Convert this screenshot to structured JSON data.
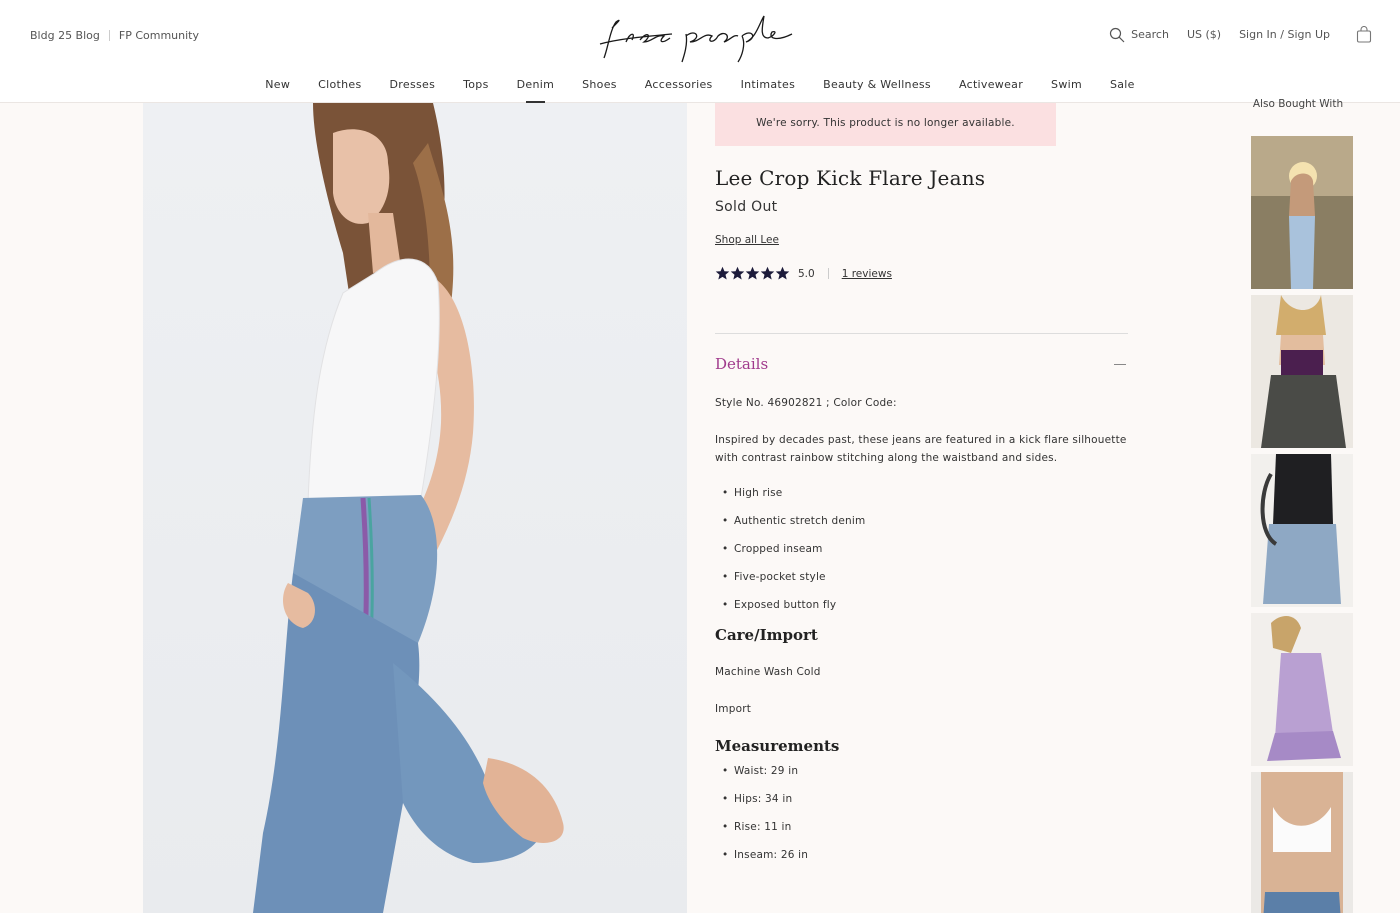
{
  "header": {
    "util_left": [
      "Bldg 25 Blog",
      "FP Community"
    ],
    "logo_text": "free people",
    "search_label": "Search",
    "currency": "US ($)",
    "account": "Sign In / Sign Up"
  },
  "nav": [
    "New",
    "Clothes",
    "Dresses",
    "Tops",
    "Denim",
    "Shoes",
    "Accessories",
    "Intimates",
    "Beauty & Wellness",
    "Activewear",
    "Swim",
    "Sale"
  ],
  "nav_active": "Denim",
  "product": {
    "alert": "We're sorry. This product is no longer available.",
    "title": "Lee Crop Kick Flare Jeans",
    "stock_status": "Sold Out",
    "shop_all": "Shop all Lee",
    "rating": "5.0",
    "stars": 5,
    "reviews": "1 reviews"
  },
  "details": {
    "title": "Details",
    "style_no": "Style No. 46902821 ; Color Code:",
    "description": "Inspired by decades past, these jeans are featured in a kick flare silhouette with contrast rainbow stitching along the waistband and sides.",
    "bullets": [
      "High rise",
      "Authentic stretch denim",
      "Cropped inseam",
      "Five-pocket style",
      "Exposed button fly"
    ],
    "care_title": "Care/Import",
    "care": [
      "Machine Wash Cold",
      "Import"
    ],
    "measurements_title": "Measurements",
    "measurements": [
      "Waist: 29 in",
      "Hips: 34 in",
      "Rise: 11 in",
      "Inseam: 26 in"
    ]
  },
  "also_bought": {
    "title": "Also Bought With"
  },
  "colors": {
    "accent": "#a03a8c",
    "alert_bg": "#fbe0e1",
    "star": "#1c1b3a"
  }
}
